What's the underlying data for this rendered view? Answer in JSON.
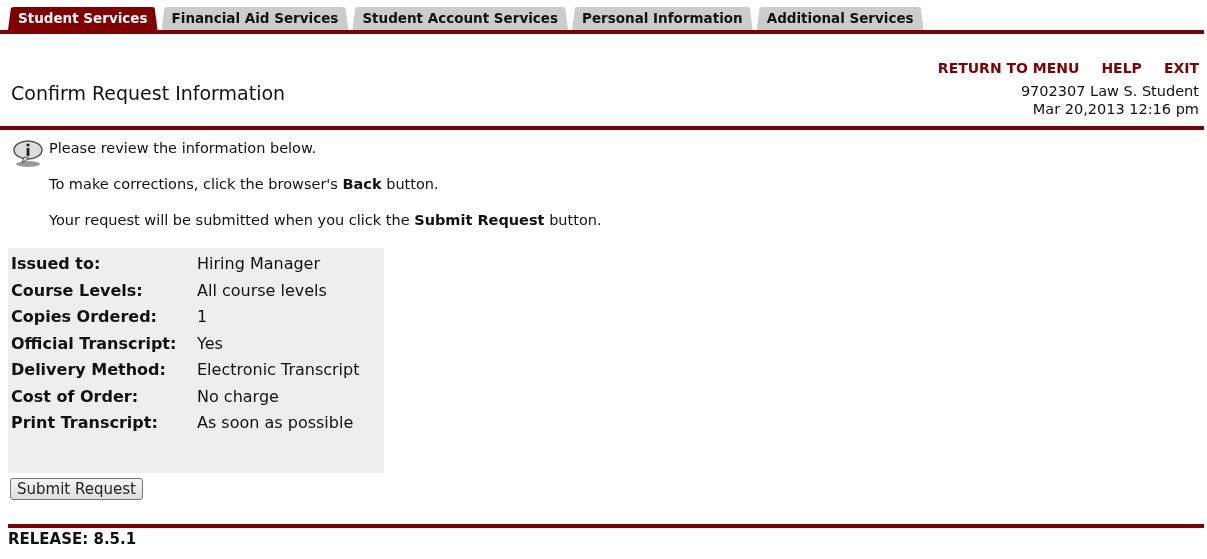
{
  "tabs": [
    {
      "label": "Student Services",
      "selected": true
    },
    {
      "label": "Financial Aid Services",
      "selected": false
    },
    {
      "label": "Student Account Services",
      "selected": false
    },
    {
      "label": "Personal Information",
      "selected": false
    },
    {
      "label": "Additional Services",
      "selected": false
    }
  ],
  "header_links": [
    "RETURN TO MENU",
    "HELP",
    "EXIT"
  ],
  "page_title": "Confirm Request Information",
  "user_info": "9702307 Law S. Student",
  "timestamp": "Mar 20,2013 12:16 pm",
  "info_messages": [
    "Please review the information below.",
    "To make corrections, click the browser's **Back** button.",
    "Your request will be submitted when you click the **Submit Request** button."
  ],
  "details": [
    {
      "label": "Issued to:",
      "value": "Hiring Manager"
    },
    {
      "label": "Course Levels:",
      "value": "All course levels"
    },
    {
      "label": "Copies Ordered:",
      "value": "1"
    },
    {
      "label": "Official Transcript:",
      "value": "Yes"
    },
    {
      "label": "Delivery Method:",
      "value": "Electronic Transcript"
    },
    {
      "label": "Cost of Order:",
      "value": "No charge"
    },
    {
      "label": "Print Transcript:",
      "value": "As soon as possible"
    }
  ],
  "submit_button": "Submit Request",
  "release": "RELEASE: 8.5.1"
}
